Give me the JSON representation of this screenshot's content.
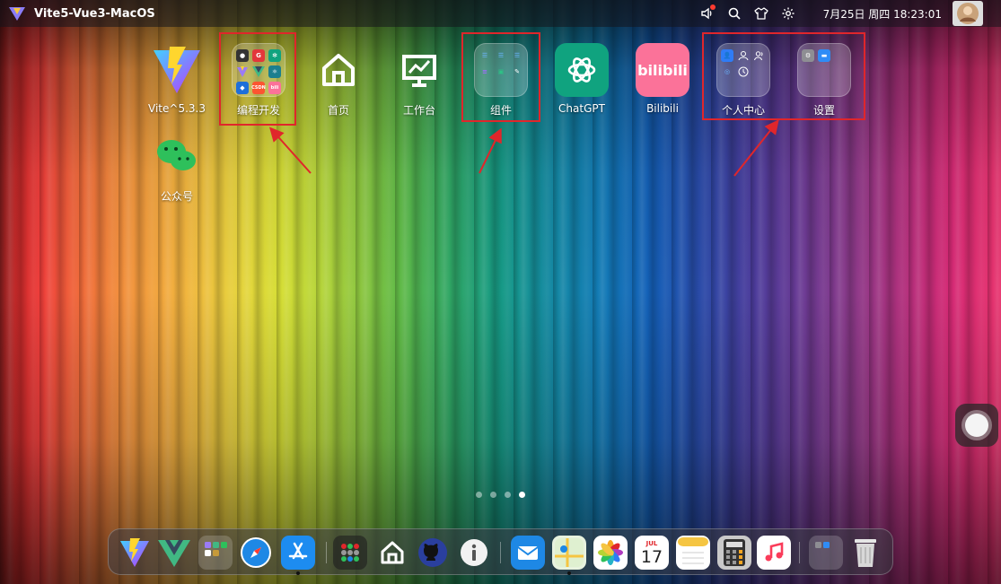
{
  "menubar": {
    "app_title": "Vite5-Vue3-MacOS",
    "clock": "7月25日 周四 18:23:01",
    "icons": [
      "volume-icon",
      "search-icon",
      "shirt-icon",
      "gear-icon",
      "avatar"
    ]
  },
  "desktop": {
    "items": [
      {
        "label": "Vite^5.3.3"
      },
      {
        "label": "编程开发"
      },
      {
        "label": "首页"
      },
      {
        "label": "工作台"
      },
      {
        "label": "组件"
      },
      {
        "label": "ChatGPT"
      },
      {
        "label": "Bilibili"
      },
      {
        "label": "个人中心"
      },
      {
        "label": "设置"
      },
      {
        "label": "公众号"
      }
    ],
    "bilibili_logo_text": "bilibili",
    "folder_badge_g": "G",
    "folder_badge_csdn": "CSDN",
    "folder_badge_bili": "bili"
  },
  "pager": {
    "count": 4,
    "active_index": 3
  },
  "dock": {
    "calendar_month": "JUL",
    "calendar_day": "17"
  },
  "colors": {
    "highlight_border": "#e0262b",
    "chatgpt_bg": "#10a37f",
    "bilibili_bg": "#fb7299",
    "wechat_green": "#2ec05b"
  }
}
